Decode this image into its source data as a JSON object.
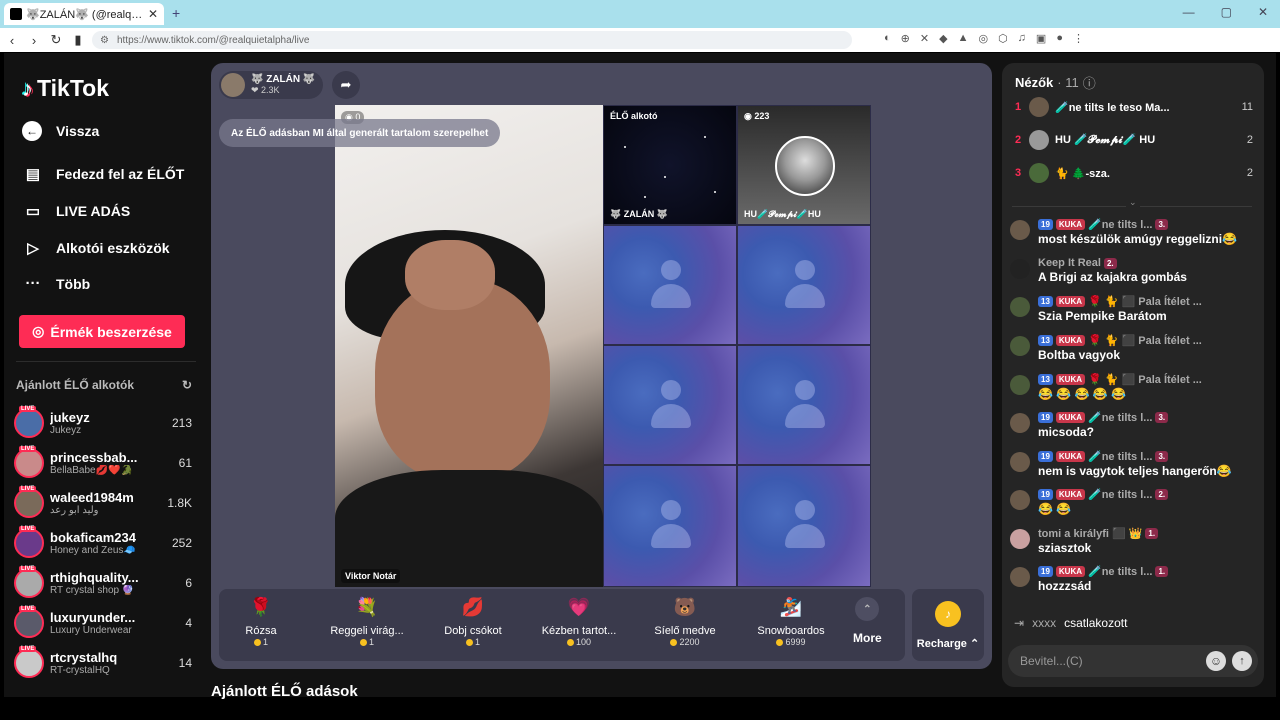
{
  "browser": {
    "tab_title": "🐺ZALÁN🐺 (@realquietalpha) | TikTok",
    "url": "https://www.tiktok.com/@realquietalpha/live",
    "new_tab": "+",
    "win_controls": [
      "—",
      "▢",
      "✕"
    ]
  },
  "sidebar": {
    "logo": "TikTok",
    "back": "Vissza",
    "menu": [
      {
        "label": "Fedezd fel az ÉLŐT",
        "icon": "live-explore-icon"
      },
      {
        "label": "LIVE ADÁS",
        "icon": "camera-icon"
      },
      {
        "label": "Alkotói eszközök",
        "icon": "creator-tools-icon"
      },
      {
        "label": "Több",
        "icon": "more-icon"
      }
    ],
    "coins_button": "Érmék beszerzése",
    "recommended_title": "Ajánlott ÉLŐ alkotók",
    "live_tag": "LIVE",
    "creators": [
      {
        "name": "jukeyz",
        "sub": "Jukeyz",
        "count": "213",
        "color": "#4a6da7"
      },
      {
        "name": "princessbab...",
        "sub": "BellaBabe💋❤️🐊",
        "count": "61",
        "color": "#c98a8a"
      },
      {
        "name": "waleed1984m",
        "sub": "وليد ابو رعد",
        "count": "1.8K",
        "color": "#7a6a5a"
      },
      {
        "name": "bokaficam234",
        "sub": "Honey and Zeus🧢",
        "count": "252",
        "color": "#6a3a8a"
      },
      {
        "name": "rthighquality...",
        "sub": "RT crystal shop 🔮",
        "count": "6",
        "color": "#aaaaaa"
      },
      {
        "name": "luxuryunder...",
        "sub": "Luxury Underwear",
        "count": "4",
        "color": "#5a5a6a"
      },
      {
        "name": "rtcrystalhq",
        "sub": "RT-crystalHQ",
        "count": "14",
        "color": "#c9c9c9"
      }
    ]
  },
  "stream": {
    "host_name": "🐺 ZALÁN 🐺",
    "host_likes": "❤ 2.3K",
    "ai_notice": "Az ÉLŐ adásban MI által generált tartalom szerepelhet",
    "cam_viewers": "◉ 0",
    "guest_name": "Viktor Notár",
    "tile_host_label": "ÉLŐ alkotó",
    "tile_host_name": "🐺 ZALÁN 🐺",
    "tile_pempi_viewers": "◉ 223",
    "tile_pempi_name": "HU🧪𝓟𝓮𝓶𝓹𝓲🧪HU"
  },
  "gifts": [
    {
      "name": "Rózsa",
      "price": "1",
      "icon": "🌹"
    },
    {
      "name": "Reggeli virág...",
      "price": "1",
      "icon": "💐"
    },
    {
      "name": "Dobj csókot",
      "price": "1",
      "icon": "💋"
    },
    {
      "name": "Kézben tartot...",
      "price": "100",
      "icon": "💗"
    },
    {
      "name": "Síelő medve",
      "price": "2200",
      "icon": "🐻"
    },
    {
      "name": "Snowboardos",
      "price": "6999",
      "icon": "🏂"
    }
  ],
  "gifts_more": "More",
  "recharge": "Recharge ⌃",
  "recommended_lives": "Ajánlott ÉLŐ adások",
  "viewers": {
    "title": "Nézők",
    "count": "· 11",
    "list": [
      {
        "rank": "1",
        "name": "🧪ne tilts le teso Ma...",
        "num": "11",
        "color": "#6a5a4a"
      },
      {
        "rank": "2",
        "name": "HU 🧪𝓟𝓮𝓶𝓹𝓲🧪 HU",
        "num": "2",
        "color": "#999999"
      },
      {
        "rank": "3",
        "name": "🐈 🌲-sza.",
        "num": "2",
        "color": "#4a6a3a"
      }
    ]
  },
  "chat": [
    {
      "level": "19",
      "club": "KUKA",
      "name": "🧪ne tilts l...",
      "rank": "3.",
      "text": "most készülök amúgy reggelizni😂",
      "color": "#6a5a4a"
    },
    {
      "level": "",
      "club": "",
      "name": "Keep It Real",
      "rank": "2.",
      "text": "A Brigi az kajakra gombás",
      "color": "#222222"
    },
    {
      "level": "13",
      "club": "KUKA",
      "name": "🌹 🐈 ⬛ Pala Ítélet ...",
      "rank": "",
      "text": "Szia Pempike Barátom",
      "color": "#4a5a3a"
    },
    {
      "level": "13",
      "club": "KUKA",
      "name": "🌹 🐈 ⬛ Pala Ítélet ...",
      "rank": "",
      "text": "Boltba vagyok",
      "color": "#4a5a3a"
    },
    {
      "level": "13",
      "club": "KUKA",
      "name": "🌹 🐈 ⬛ Pala Ítélet ...",
      "rank": "",
      "text": "😂 😂 😂 😂 😂",
      "color": "#4a5a3a"
    },
    {
      "level": "19",
      "club": "KUKA",
      "name": "🧪ne tilts l...",
      "rank": "3.",
      "text": "micsoda?",
      "color": "#6a5a4a"
    },
    {
      "level": "19",
      "club": "KUKA",
      "name": "🧪ne tilts l...",
      "rank": "3.",
      "text": "nem is vagytok teljes hangerőn😂",
      "color": "#6a5a4a"
    },
    {
      "level": "19",
      "club": "KUKA",
      "name": "🧪ne tilts l...",
      "rank": "2.",
      "text": "😂 😂",
      "color": "#6a5a4a"
    },
    {
      "level": "",
      "club": "",
      "name": "tomi a királyfi ⬛ 👑",
      "rank": "1.",
      "text": "sziasztok",
      "color": "#c9a0a0"
    },
    {
      "level": "19",
      "club": "KUKA",
      "name": "🧪ne tilts l...",
      "rank": "1.",
      "text": "hozzzsád",
      "color": "#6a5a4a"
    }
  ],
  "joined": {
    "user": "xxxx",
    "text": "csatlakozott"
  },
  "input": {
    "placeholder": "Bevitel...(C)"
  }
}
